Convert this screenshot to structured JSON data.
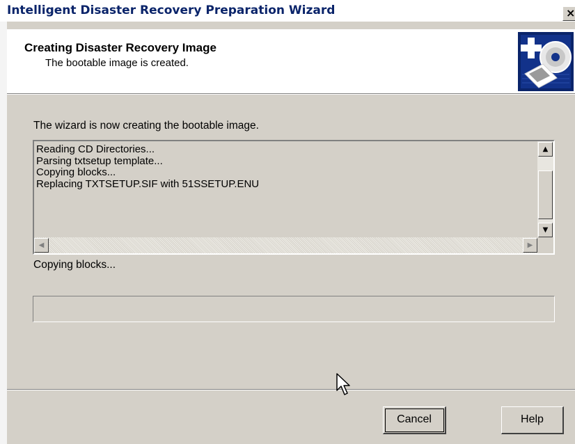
{
  "window": {
    "title": "Intelligent Disaster Recovery Preparation Wizard",
    "close_label": "×"
  },
  "header": {
    "title": "Creating Disaster Recovery Image",
    "subtitle": "The bootable image is created.",
    "icon": "disaster-recovery-wizard-icon"
  },
  "main": {
    "intro": "The wizard is now creating the bootable image.",
    "log_lines": [
      "Reading CD Directories...",
      "Parsing txtsetup template...",
      "Copying blocks...",
      "Replacing TXTSETUP.SIF with 51SSETUP.ENU"
    ],
    "status": "Copying blocks...",
    "progress_fraction": 0
  },
  "buttons": {
    "cancel": "Cancel",
    "help": "Help"
  },
  "colors": {
    "dialog_bg": "#d4d0c8",
    "title_text": "#0a246a"
  }
}
